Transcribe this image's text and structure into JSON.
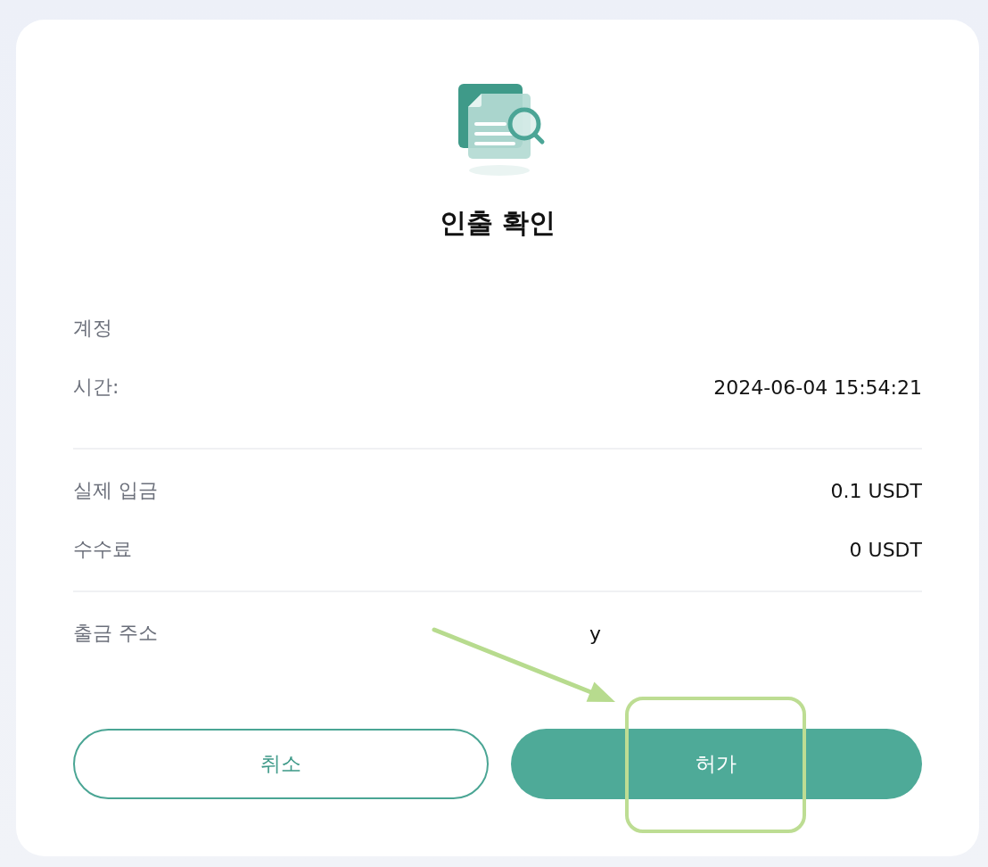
{
  "dialog": {
    "title": "인출 확인"
  },
  "sections": [
    {
      "rows": [
        {
          "kind": "text",
          "label": "계정"
        },
        {
          "kind": "text",
          "label": "시간:",
          "value": "2024-06-04 15:54:21"
        }
      ]
    },
    {
      "rows": [
        {
          "kind": "text",
          "label": "실제 입금",
          "value": "0.1 USDT"
        },
        {
          "kind": "text",
          "label": "수수료",
          "value": "0 USDT"
        }
      ]
    },
    {
      "rows": [
        {
          "kind": "address",
          "label": "출금 주소",
          "value": "y"
        }
      ]
    }
  ],
  "buttons": [
    {
      "kind": "outline",
      "label": "취소"
    },
    {
      "kind": "primary",
      "label": "허가"
    }
  ],
  "annotation": {
    "arrow": true,
    "highlight_box": true
  }
}
